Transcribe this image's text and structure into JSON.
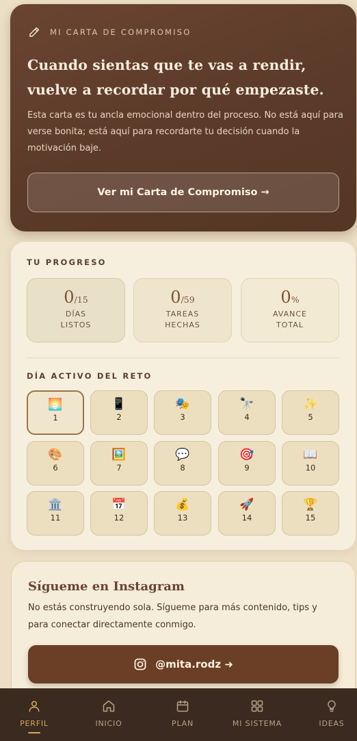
{
  "letter": {
    "eyebrow": "MI CARTA DE COMPROMISO",
    "title": "Cuando sientas que te vas a rendir, vuelve a recordar por qué empezaste.",
    "description": "Esta carta es tu ancla emocional dentro del proceso. No está aquí para verse bonita; está aquí para recordarte tu decisión cuando la motivación baje.",
    "button_label": "Ver mi Carta de Compromiso →",
    "icon": "pencil-icon"
  },
  "progress": {
    "eyebrow": "TU PROGRESO",
    "stats": [
      {
        "value": "0",
        "suffix": "/15",
        "label_line1": "DÍAS",
        "label_line2": "LISTOS"
      },
      {
        "value": "0",
        "suffix": "/59",
        "label_line1": "TAREAS",
        "label_line2": "HECHAS"
      },
      {
        "value": "0",
        "suffix": "%",
        "label_line1": "AVANCE",
        "label_line2": "TOTAL"
      }
    ],
    "day_eyebrow": "DÍA ACTIVO DEL RETO",
    "active_day": 1,
    "days": [
      {
        "number": "1",
        "emoji": "🌅"
      },
      {
        "number": "2",
        "emoji": "📱"
      },
      {
        "number": "3",
        "emoji": "🎭"
      },
      {
        "number": "4",
        "emoji": "🔭"
      },
      {
        "number": "5",
        "emoji": "✨"
      },
      {
        "number": "6",
        "emoji": "🎨"
      },
      {
        "number": "7",
        "emoji": "🖼️"
      },
      {
        "number": "8",
        "emoji": "💬"
      },
      {
        "number": "9",
        "emoji": "🎯"
      },
      {
        "number": "10",
        "emoji": "📖"
      },
      {
        "number": "11",
        "emoji": "🏛️"
      },
      {
        "number": "12",
        "emoji": "📅"
      },
      {
        "number": "13",
        "emoji": "💰"
      },
      {
        "number": "14",
        "emoji": "🚀"
      },
      {
        "number": "15",
        "emoji": "🏆"
      }
    ]
  },
  "instagram": {
    "title": "Sígueme en Instagram",
    "description": "No estás construyendo sola. Sígueme para más contenido, tips y para conectar directamente conmigo.",
    "button_label": "@mita.rodz ➜",
    "icon": "instagram-icon"
  },
  "nav": {
    "active": "PERFIL",
    "items": [
      {
        "label": "PERFIL",
        "icon": "user-icon"
      },
      {
        "label": "INICIO",
        "icon": "home-icon"
      },
      {
        "label": "PLAN",
        "icon": "calendar-icon"
      },
      {
        "label": "MI SISTEMA",
        "icon": "grid-icon"
      },
      {
        "label": "IDEAS",
        "icon": "lightbulb-icon"
      }
    ]
  },
  "colors": {
    "background": "#ecdfc6",
    "letter_card": "#5b3a29",
    "accent": "#d9a85d",
    "nav_bg": "#3a2a1f",
    "instagram_button": "#6a3f25"
  }
}
